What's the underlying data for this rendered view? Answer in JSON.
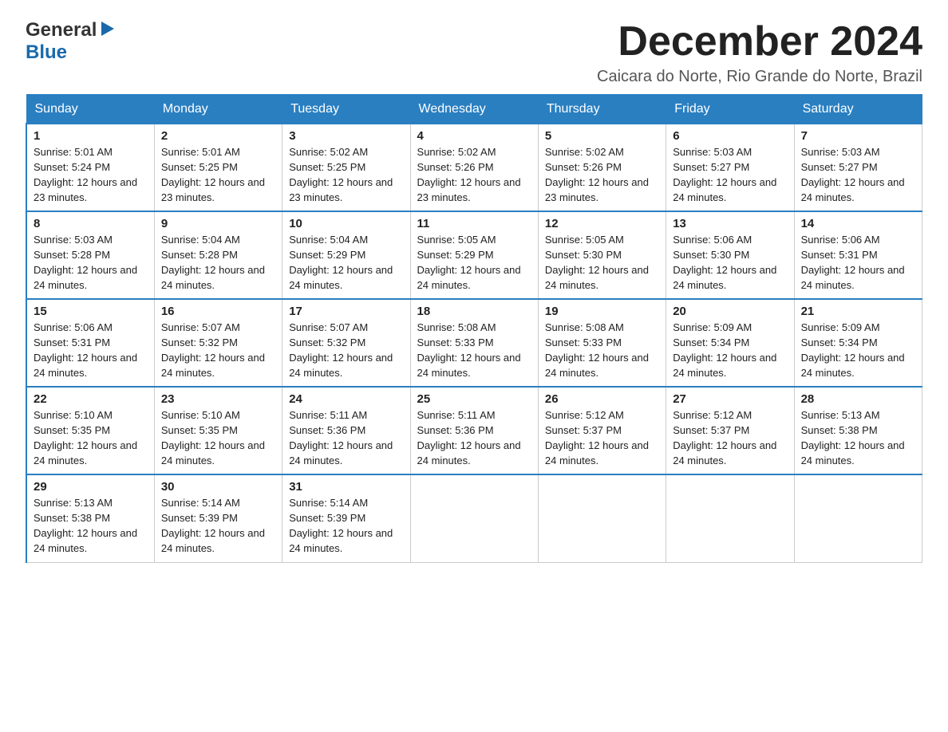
{
  "logo": {
    "general": "General",
    "blue": "Blue",
    "triangle": "▶"
  },
  "header": {
    "month_title": "December 2024",
    "location": "Caicara do Norte, Rio Grande do Norte, Brazil"
  },
  "weekdays": [
    "Sunday",
    "Monday",
    "Tuesday",
    "Wednesday",
    "Thursday",
    "Friday",
    "Saturday"
  ],
  "weeks": [
    [
      {
        "day": "1",
        "sunrise": "5:01 AM",
        "sunset": "5:24 PM",
        "daylight": "12 hours and 23 minutes."
      },
      {
        "day": "2",
        "sunrise": "5:01 AM",
        "sunset": "5:25 PM",
        "daylight": "12 hours and 23 minutes."
      },
      {
        "day": "3",
        "sunrise": "5:02 AM",
        "sunset": "5:25 PM",
        "daylight": "12 hours and 23 minutes."
      },
      {
        "day": "4",
        "sunrise": "5:02 AM",
        "sunset": "5:26 PM",
        "daylight": "12 hours and 23 minutes."
      },
      {
        "day": "5",
        "sunrise": "5:02 AM",
        "sunset": "5:26 PM",
        "daylight": "12 hours and 23 minutes."
      },
      {
        "day": "6",
        "sunrise": "5:03 AM",
        "sunset": "5:27 PM",
        "daylight": "12 hours and 24 minutes."
      },
      {
        "day": "7",
        "sunrise": "5:03 AM",
        "sunset": "5:27 PM",
        "daylight": "12 hours and 24 minutes."
      }
    ],
    [
      {
        "day": "8",
        "sunrise": "5:03 AM",
        "sunset": "5:28 PM",
        "daylight": "12 hours and 24 minutes."
      },
      {
        "day": "9",
        "sunrise": "5:04 AM",
        "sunset": "5:28 PM",
        "daylight": "12 hours and 24 minutes."
      },
      {
        "day": "10",
        "sunrise": "5:04 AM",
        "sunset": "5:29 PM",
        "daylight": "12 hours and 24 minutes."
      },
      {
        "day": "11",
        "sunrise": "5:05 AM",
        "sunset": "5:29 PM",
        "daylight": "12 hours and 24 minutes."
      },
      {
        "day": "12",
        "sunrise": "5:05 AM",
        "sunset": "5:30 PM",
        "daylight": "12 hours and 24 minutes."
      },
      {
        "day": "13",
        "sunrise": "5:06 AM",
        "sunset": "5:30 PM",
        "daylight": "12 hours and 24 minutes."
      },
      {
        "day": "14",
        "sunrise": "5:06 AM",
        "sunset": "5:31 PM",
        "daylight": "12 hours and 24 minutes."
      }
    ],
    [
      {
        "day": "15",
        "sunrise": "5:06 AM",
        "sunset": "5:31 PM",
        "daylight": "12 hours and 24 minutes."
      },
      {
        "day": "16",
        "sunrise": "5:07 AM",
        "sunset": "5:32 PM",
        "daylight": "12 hours and 24 minutes."
      },
      {
        "day": "17",
        "sunrise": "5:07 AM",
        "sunset": "5:32 PM",
        "daylight": "12 hours and 24 minutes."
      },
      {
        "day": "18",
        "sunrise": "5:08 AM",
        "sunset": "5:33 PM",
        "daylight": "12 hours and 24 minutes."
      },
      {
        "day": "19",
        "sunrise": "5:08 AM",
        "sunset": "5:33 PM",
        "daylight": "12 hours and 24 minutes."
      },
      {
        "day": "20",
        "sunrise": "5:09 AM",
        "sunset": "5:34 PM",
        "daylight": "12 hours and 24 minutes."
      },
      {
        "day": "21",
        "sunrise": "5:09 AM",
        "sunset": "5:34 PM",
        "daylight": "12 hours and 24 minutes."
      }
    ],
    [
      {
        "day": "22",
        "sunrise": "5:10 AM",
        "sunset": "5:35 PM",
        "daylight": "12 hours and 24 minutes."
      },
      {
        "day": "23",
        "sunrise": "5:10 AM",
        "sunset": "5:35 PM",
        "daylight": "12 hours and 24 minutes."
      },
      {
        "day": "24",
        "sunrise": "5:11 AM",
        "sunset": "5:36 PM",
        "daylight": "12 hours and 24 minutes."
      },
      {
        "day": "25",
        "sunrise": "5:11 AM",
        "sunset": "5:36 PM",
        "daylight": "12 hours and 24 minutes."
      },
      {
        "day": "26",
        "sunrise": "5:12 AM",
        "sunset": "5:37 PM",
        "daylight": "12 hours and 24 minutes."
      },
      {
        "day": "27",
        "sunrise": "5:12 AM",
        "sunset": "5:37 PM",
        "daylight": "12 hours and 24 minutes."
      },
      {
        "day": "28",
        "sunrise": "5:13 AM",
        "sunset": "5:38 PM",
        "daylight": "12 hours and 24 minutes."
      }
    ],
    [
      {
        "day": "29",
        "sunrise": "5:13 AM",
        "sunset": "5:38 PM",
        "daylight": "12 hours and 24 minutes."
      },
      {
        "day": "30",
        "sunrise": "5:14 AM",
        "sunset": "5:39 PM",
        "daylight": "12 hours and 24 minutes."
      },
      {
        "day": "31",
        "sunrise": "5:14 AM",
        "sunset": "5:39 PM",
        "daylight": "12 hours and 24 minutes."
      },
      null,
      null,
      null,
      null
    ]
  ],
  "labels": {
    "sunrise_prefix": "Sunrise: ",
    "sunset_prefix": "Sunset: ",
    "daylight_prefix": "Daylight: "
  }
}
